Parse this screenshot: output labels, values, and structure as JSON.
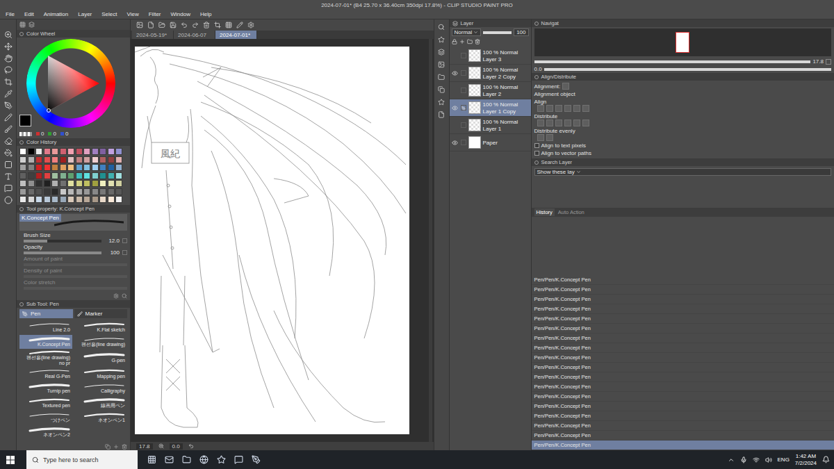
{
  "window": {
    "title": "2024-07-01* (B4 25.70 x 36.40cm 350dpi 17.8%) - CLIP STUDIO PAINT PRO"
  },
  "menu": [
    "File",
    "Edit",
    "Animation",
    "Layer",
    "Select",
    "View",
    "Filter",
    "Window",
    "Help"
  ],
  "doc_tabs": [
    {
      "label": "2024-05-19*",
      "selected": false
    },
    {
      "label": "2024-06-07",
      "selected": false
    },
    {
      "label": "2024-07-01*",
      "selected": true
    }
  ],
  "color_wheel": {
    "title": "Color Wheel",
    "current_color": "#000000",
    "rgb": [
      {
        "value": "0",
        "color": "#d03030"
      },
      {
        "value": "0",
        "color": "#30a030"
      },
      {
        "value": "0",
        "color": "#3050d0"
      }
    ]
  },
  "color_history": {
    "title": "Color History",
    "swatches": [
      "#ffffff",
      "#000000",
      "#e8e8e8",
      "#e07a8a",
      "#e89a9a",
      "#d06070",
      "#f0a0b0",
      "#c05060",
      "#e0a0c0",
      "#a080c0",
      "#8060a0",
      "#c0a0e0",
      "#9090d0",
      "#d0d0d0",
      "#b0b0b0",
      "#c03030",
      "#e05050",
      "#f08080",
      "#a02020",
      "#e0c0c0",
      "#c08080",
      "#d0a0a0",
      "#f0d0d0",
      "#b06060",
      "#904040",
      "#e0b0b0",
      "#a0a0a0",
      "#808080",
      "#d02020",
      "#f03030",
      "#c08040",
      "#e0a060",
      "#f0c080",
      "#60a0d0",
      "#80c0e0",
      "#a0d0f0",
      "#4080c0",
      "#2060a0",
      "#90b0d0",
      "#606060",
      "#404040",
      "#b02020",
      "#e04040",
      "#a0c0a0",
      "#80b090",
      "#60a070",
      "#40c0c0",
      "#60e0e0",
      "#80d0d0",
      "#209090",
      "#40b0b0",
      "#a0e0e0",
      "#c0c0c0",
      "#909090",
      "#303030",
      "#202020",
      "#b0b0b0",
      "#707070",
      "#e0e0a0",
      "#d0d080",
      "#c0c060",
      "#a0a040",
      "#f0f0c0",
      "#e0e0b0",
      "#d0d0a0",
      "#9a9a9a",
      "#6a6a6a",
      "#505050",
      "#3a3a3a",
      "#2a2a2a",
      "#c8c8c8",
      "#b8b8b8",
      "#a8a8a8",
      "#989898",
      "#888888",
      "#787878",
      "#686868",
      "#585858",
      "#e8e8e8",
      "#d8d8d8",
      "#c8d8e8",
      "#b8c8d8",
      "#a8b8c8",
      "#98a8b8",
      "#d8c8b8",
      "#c8b8a8",
      "#b8a898",
      "#a89888",
      "#e8d8c8",
      "#f8e8d8",
      "#f0f0f0"
    ]
  },
  "tool_property": {
    "title": "Tool property: K.Concept Pen",
    "tool": "K.Concept Pen",
    "properties": [
      {
        "label": "Brush Size",
        "value": "12.0",
        "level": 0.3,
        "disabled": false
      },
      {
        "label": "Opacity",
        "value": "100",
        "level": 1,
        "disabled": false
      },
      {
        "label": "Amount of paint",
        "level": 0,
        "disabled": true
      },
      {
        "label": "Density of paint",
        "level": 0,
        "disabled": true
      },
      {
        "label": "Color stretch",
        "level": 0,
        "disabled": true
      }
    ]
  },
  "sub_tool": {
    "title": "Sub Tool: Pen",
    "tabs": [
      {
        "label": "Pen",
        "selected": true
      },
      {
        "label": "Marker",
        "selected": false
      }
    ],
    "brushes": [
      {
        "label": "Line 2.0",
        "selected": false
      },
      {
        "label": "K.Flat sketch",
        "selected": false
      },
      {
        "label": "K.Concept Pen",
        "selected": true
      },
      {
        "label": "펜선용(line drawing)",
        "selected": false
      },
      {
        "label": "펜선용(line drawing) no pr",
        "selected": false
      },
      {
        "label": "G-pen",
        "selected": false
      },
      {
        "label": "Real G-Pen",
        "selected": false
      },
      {
        "label": "Mapping pen",
        "selected": false
      },
      {
        "label": "Turnip pen",
        "selected": false
      },
      {
        "label": "Calligraphy",
        "selected": false
      },
      {
        "label": "Textured pen",
        "selected": false
      },
      {
        "label": "線画用ペン",
        "selected": false
      },
      {
        "label": "つけペン",
        "selected": false
      },
      {
        "label": "ネオンペン1",
        "selected": false
      },
      {
        "label": "ネオンペン2",
        "selected": false
      }
    ]
  },
  "layer_panel": {
    "title": "Layer",
    "blend_mode": "Normal",
    "opacity": "100",
    "layers": [
      {
        "name": "Layer 3",
        "opacity": "100 %",
        "mode": "Normal",
        "visible": false,
        "selected": false,
        "kind": "raster"
      },
      {
        "name": "Layer 2 Copy",
        "opacity": "100 %",
        "mode": "Normal",
        "visible": true,
        "selected": false,
        "kind": "raster"
      },
      {
        "name": "Layer 2",
        "opacity": "100 %",
        "mode": "Normal",
        "visible": false,
        "selected": false,
        "kind": "raster"
      },
      {
        "name": "Layer 1 Copy",
        "opacity": "100 %",
        "mode": "Normal",
        "visible": true,
        "selected": true,
        "kind": "raster"
      },
      {
        "name": "Layer 1",
        "opacity": "100 %",
        "mode": "Normal",
        "visible": false,
        "selected": false,
        "kind": "raster"
      },
      {
        "name": "Paper",
        "visible": true,
        "selected": false,
        "kind": "paper"
      }
    ]
  },
  "navigator": {
    "title": "Navigat",
    "zoom": "17.8",
    "angle": "0.0"
  },
  "align": {
    "title": "Align/Distribute",
    "alignment_label": "Alignment:",
    "alignment_object": "Alignment object",
    "sections": [
      "Align",
      "Distribute",
      "Distribute evenly"
    ],
    "options": [
      {
        "label": "Align to text pixels",
        "checked": false
      },
      {
        "label": "Align to vector paths",
        "checked": false
      }
    ]
  },
  "search_layer": {
    "title": "Search Layer",
    "filter": "Show these lay"
  },
  "history": {
    "tabs": [
      {
        "label": "History",
        "selected": true
      },
      {
        "label": "Auto Action",
        "selected": false
      }
    ],
    "rows": [
      {
        "label": "Pen/Pen/K.Concept Pen",
        "selected": false
      },
      {
        "label": "Pen/Pen/K.Concept Pen",
        "selected": false
      },
      {
        "label": "Pen/Pen/K.Concept Pen",
        "selected": false
      },
      {
        "label": "Pen/Pen/K.Concept Pen",
        "selected": false
      },
      {
        "label": "Pen/Pen/K.Concept Pen",
        "selected": false
      },
      {
        "label": "Pen/Pen/K.Concept Pen",
        "selected": false
      },
      {
        "label": "Pen/Pen/K.Concept Pen",
        "selected": false
      },
      {
        "label": "Pen/Pen/K.Concept Pen",
        "selected": false
      },
      {
        "label": "Pen/Pen/K.Concept Pen",
        "selected": false
      },
      {
        "label": "Pen/Pen/K.Concept Pen",
        "selected": false
      },
      {
        "label": "Pen/Pen/K.Concept Pen",
        "selected": false
      },
      {
        "label": "Pen/Pen/K.Concept Pen",
        "selected": false
      },
      {
        "label": "Pen/Pen/K.Concept Pen",
        "selected": false
      },
      {
        "label": "Pen/Pen/K.Concept Pen",
        "selected": false
      },
      {
        "label": "Pen/Pen/K.Concept Pen",
        "selected": false
      },
      {
        "label": "Pen/Pen/K.Concept Pen",
        "selected": false
      },
      {
        "label": "Pen/Pen/K.Concept Pen",
        "selected": false
      },
      {
        "label": "Pen/Pen/K.Concept Pen",
        "selected": true
      }
    ]
  },
  "canvas": {
    "zoom": "17.8",
    "angle": "0.0",
    "armband": "風紀"
  },
  "taskbar": {
    "search_placeholder": "Type here to search",
    "language": "ENG",
    "time": "1:42 AM",
    "date": "7/2/2024"
  }
}
